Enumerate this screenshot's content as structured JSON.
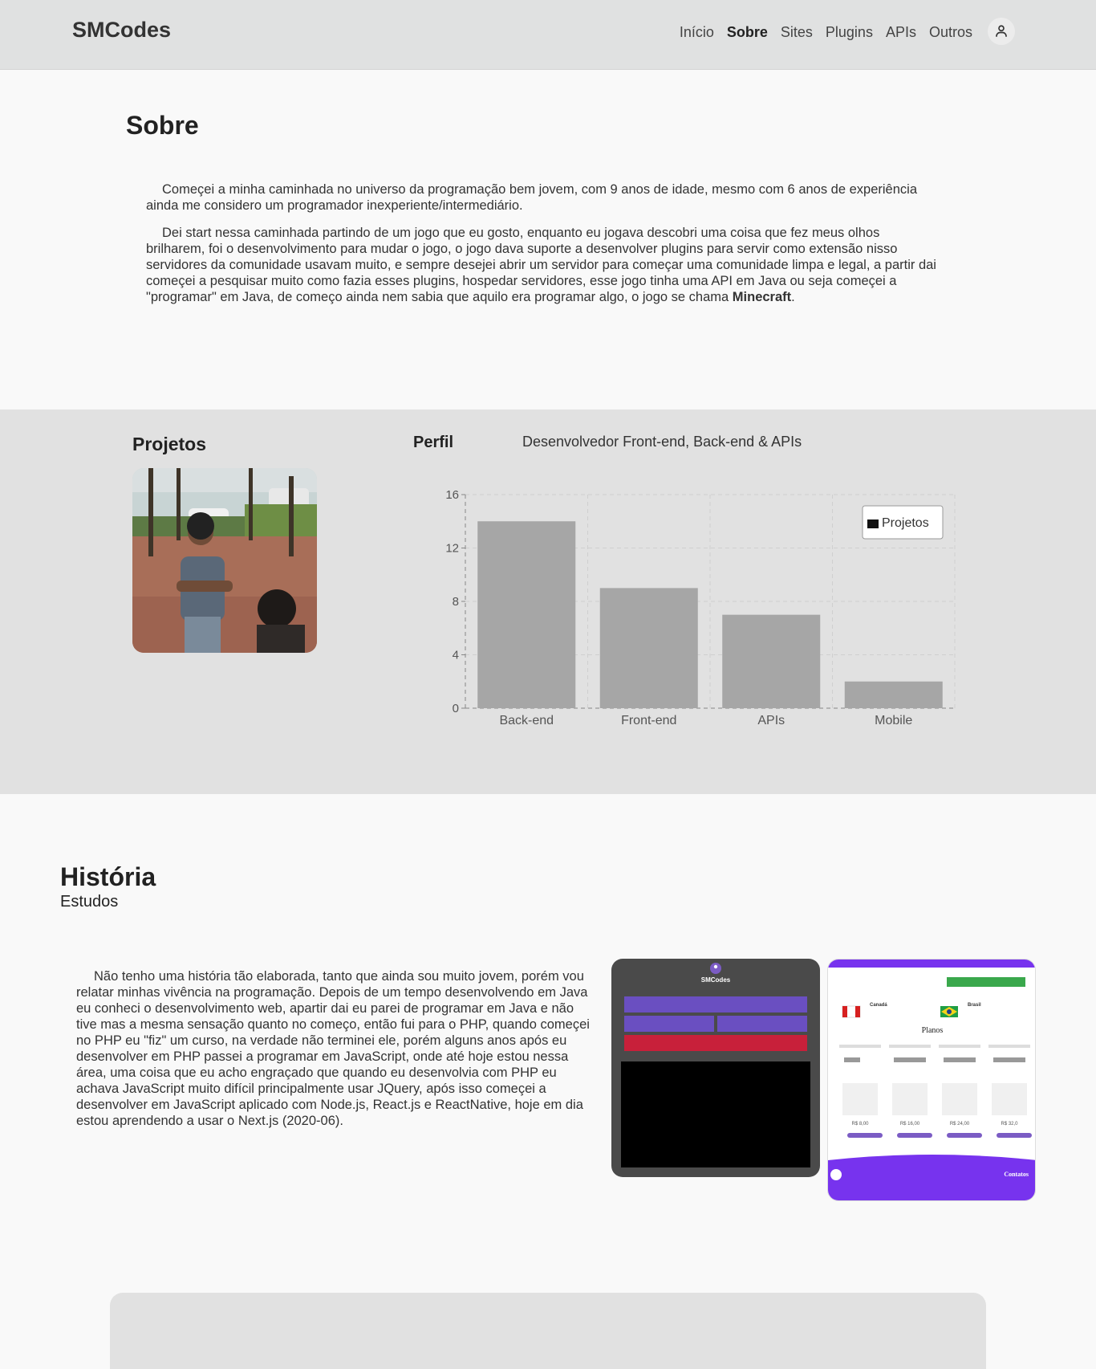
{
  "header": {
    "logo": "SMCodes",
    "nav": [
      "Início",
      "Sobre",
      "Sites",
      "Plugins",
      "APIs",
      "Outros"
    ],
    "active": "Sobre"
  },
  "sobre": {
    "title": "Sobre",
    "p1": "Começei a minha caminhada no universo da programação bem jovem, com 9 anos de idade, mesmo com 6 anos de experiência ainda me considero um programador inexperiente/intermediário.",
    "p2_before": "Dei start nessa caminhada partindo de um jogo que eu gosto, enquanto eu jogava descobri uma coisa que fez meus olhos brilharem, foi o desenvolvimento para mudar o jogo, o jogo dava suporte a desenvolver plugins para servir como extensão nisso servidores da comunidade usavam muito, e sempre desejei abrir um servidor para começar uma comunidade limpa e legal, a partir dai começei a pesquisar muito como fazia esses plugins, hospedar servidores, esse jogo tinha uma API em Java ou seja começei a \"programar\" em Java, de começo ainda nem sabia que aquilo era programar algo, o jogo se chama ",
    "p2_bold": "Minecraft",
    "p2_after": "."
  },
  "projetos": {
    "title": "Projetos"
  },
  "perfil": {
    "label": "Perfil",
    "subtitle": "Desenvolvedor Front-end, Back-end & APIs"
  },
  "chart_data": {
    "type": "bar",
    "categories": [
      "Back-end",
      "Front-end",
      "APIs",
      "Mobile"
    ],
    "series": [
      {
        "name": "Projetos",
        "values": [
          14,
          9,
          7,
          2
        ]
      }
    ],
    "ylim": [
      0,
      16
    ],
    "yticks": [
      0,
      4,
      8,
      12,
      16
    ],
    "grid": true,
    "legend_position": "top-right",
    "bar_color": "#a6a6a6"
  },
  "historia": {
    "title": "História",
    "subtitle": "Estudos",
    "text": "Não tenho uma história tão elaborada, tanto que ainda sou muito jovem, porém vou relatar minhas vivência na programação. Depois de um tempo desenvolvendo em Java eu conheci o desenvolvimento web, apartir dai eu parei de programar em Java e não tive mas a mesma sensação quanto no começo, então fui para o PHP, quando começei no PHP eu \"fiz\" um curso, na verdade não terminei ele, porém alguns anos após eu desenvolver em PHP passei a programar em JavaScript, onde até hoje estou nessa área, uma coisa que eu acho engraçado que quando eu desenvolvia com PHP eu achava JavaScript muito difícil principalmente usar JQuery, após isso começei a desenvolver em JavaScript aplicado com Node.js, React.js e ReactNative, hoje em dia estou aprendendo a usar o Next.js (2020-06)."
  },
  "shot1": {
    "brand": "SMCodes"
  },
  "shot2": {
    "heading": "Planos",
    "footer": "Contatos",
    "country1": "Canadá",
    "country2": "Brasil",
    "prices": [
      "R$ 8,00",
      "R$ 16,00",
      "R$ 24,00",
      "R$ 32,0"
    ]
  }
}
